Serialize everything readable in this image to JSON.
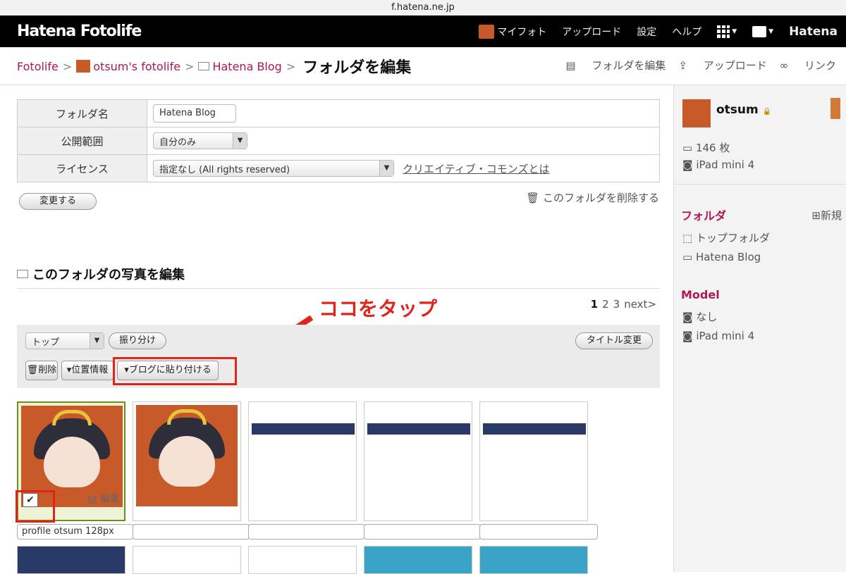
{
  "browser": {
    "url": "f.hatena.ne.jp"
  },
  "header": {
    "logo": "Hatena Fotolife",
    "nav": [
      "マイフォト",
      "アップロード",
      "設定",
      "ヘルプ"
    ],
    "hatena": "Hatena"
  },
  "breadcrumb": {
    "root": "Fotolife",
    "user": "otsum's fotolife",
    "folder": "Hatena Blog",
    "current": "フォルダを編集",
    "sep": ">"
  },
  "actions": {
    "edit_folder": "フォルダを編集",
    "upload": "アップロード",
    "link": "リンク"
  },
  "form": {
    "name_label": "フォルダ名",
    "name_value": "Hatena Blog",
    "scope_label": "公開範囲",
    "scope_value": "自分のみ",
    "license_label": "ライセンス",
    "license_value": "指定なし (All rights reserved)",
    "cc_link": "クリエイティブ・コモンズとは",
    "submit": "変更する",
    "delete_folder": "このフォルダを削除する"
  },
  "photos": {
    "title": "このフォルダの写真を編集",
    "pages": [
      "1",
      "2",
      "3"
    ],
    "next": "next>",
    "callout": "ココをタップ",
    "sort_value": "トップ",
    "assign": "振り分け",
    "rename": "タイトル変更",
    "delete": "削除",
    "location": "位置情報",
    "paste_blog": "ブログに貼り付ける",
    "edit_label": "編集",
    "first_caption": "profile otsum 128px"
  },
  "sidebar": {
    "username": "otsum",
    "count": "146 枚",
    "device": "iPad mini 4",
    "folder_heading": "フォルダ",
    "new_label": "新規",
    "folders": [
      "トップフォルダ",
      "Hatena Blog"
    ],
    "model_heading": "Model",
    "models": [
      "なし",
      "iPad mini 4"
    ]
  },
  "colors": {
    "accent": "#b01655",
    "callout": "#e0241b",
    "selected": "#6d8f1e"
  }
}
